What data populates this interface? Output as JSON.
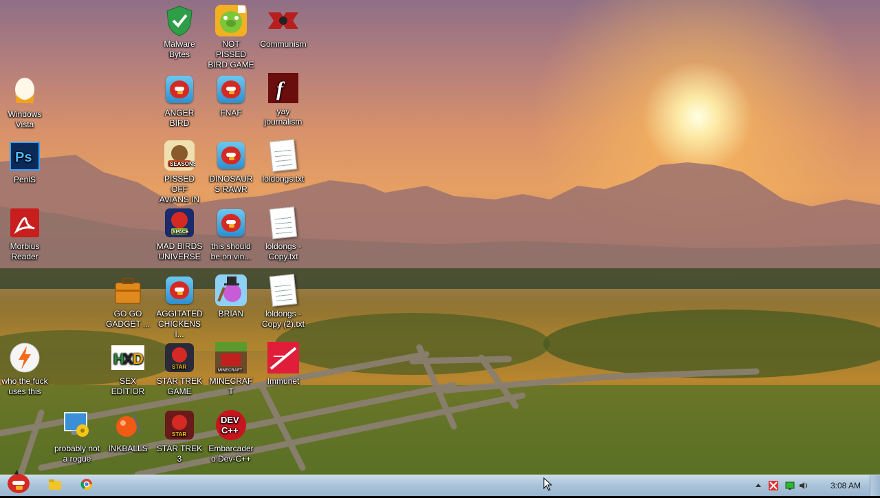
{
  "desktop": {
    "icons": [
      {
        "label": "Malware Bytes",
        "icon": "shield-check-icon"
      },
      {
        "label": "NOT PISSED BIRD GAME",
        "icon": "green-pig-icon"
      },
      {
        "label": "Communism",
        "icon": "red-emblem-icon"
      },
      {
        "label": "Windows Vista",
        "icon": "egg-icon"
      },
      {
        "label": "ANGER BIRD",
        "icon": "angry-bird-icon"
      },
      {
        "label": "FNAF",
        "icon": "angry-bird-icon"
      },
      {
        "label": "yay journalism",
        "icon": "flash-icon"
      },
      {
        "label": "PeniS",
        "icon": "photoshop-icon"
      },
      {
        "label": "PISSED OFF AVIANS IN ...",
        "icon": "seasons-icon"
      },
      {
        "label": "DINOSAURS RAWR",
        "icon": "angry-bird-icon"
      },
      {
        "label": "loldongs.txt",
        "icon": "text-file-icon"
      },
      {
        "label": "Morbius Reader",
        "icon": "pdf-reader-icon"
      },
      {
        "label": "MAD BIRDS UNIVERSE",
        "icon": "space-bird-icon"
      },
      {
        "label": "this should be on vin...",
        "icon": "angry-bird-icon"
      },
      {
        "label": "loldongs - Copy.txt",
        "icon": "text-file-icon"
      },
      {
        "label": "GO GO GADGET ...",
        "icon": "briefcase-icon"
      },
      {
        "label": "AGGITATED CHICKENS I...",
        "icon": "angry-bird-icon"
      },
      {
        "label": "BRIAN",
        "icon": "character-icon"
      },
      {
        "label": "loldongs - Copy (2).txt",
        "icon": "text-file-icon"
      },
      {
        "label": "who the fuck uses this",
        "icon": "lightning-icon"
      },
      {
        "label": "SEX EDITIOR",
        "icon": "hex-editor-icon"
      },
      {
        "label": "STAR TREK GAME",
        "icon": "star-wars-bird-icon"
      },
      {
        "label": "MINECRAFT",
        "icon": "minecraft-icon"
      },
      {
        "label": "Immunet",
        "icon": "immunet-icon"
      },
      {
        "label": "probably not a rogue",
        "icon": "settings-monitor-icon"
      },
      {
        "label": "INKBALLS",
        "icon": "ink-ball-icon"
      },
      {
        "label": "STAR TREK 3",
        "icon": "star-wars-bird-icon"
      },
      {
        "label": "Embarcadero Dev-C++",
        "icon": "devcpp-icon"
      }
    ]
  },
  "taskbar": {
    "start_icon": "angry-bird-start-icon",
    "pinned": [
      {
        "name": "explorer",
        "icon": "folder-icon"
      },
      {
        "name": "chrome",
        "icon": "chrome-icon"
      }
    ],
    "tray": {
      "expand_icon": "up-arrow-icon",
      "icons": [
        "flag-icon",
        "network-icon",
        "volume-icon"
      ],
      "clock": "3:08 AM"
    }
  },
  "colors": {
    "taskbar": "#a9c3d9",
    "sky_top": "#8f6f86",
    "sun": "#fff4c0"
  }
}
